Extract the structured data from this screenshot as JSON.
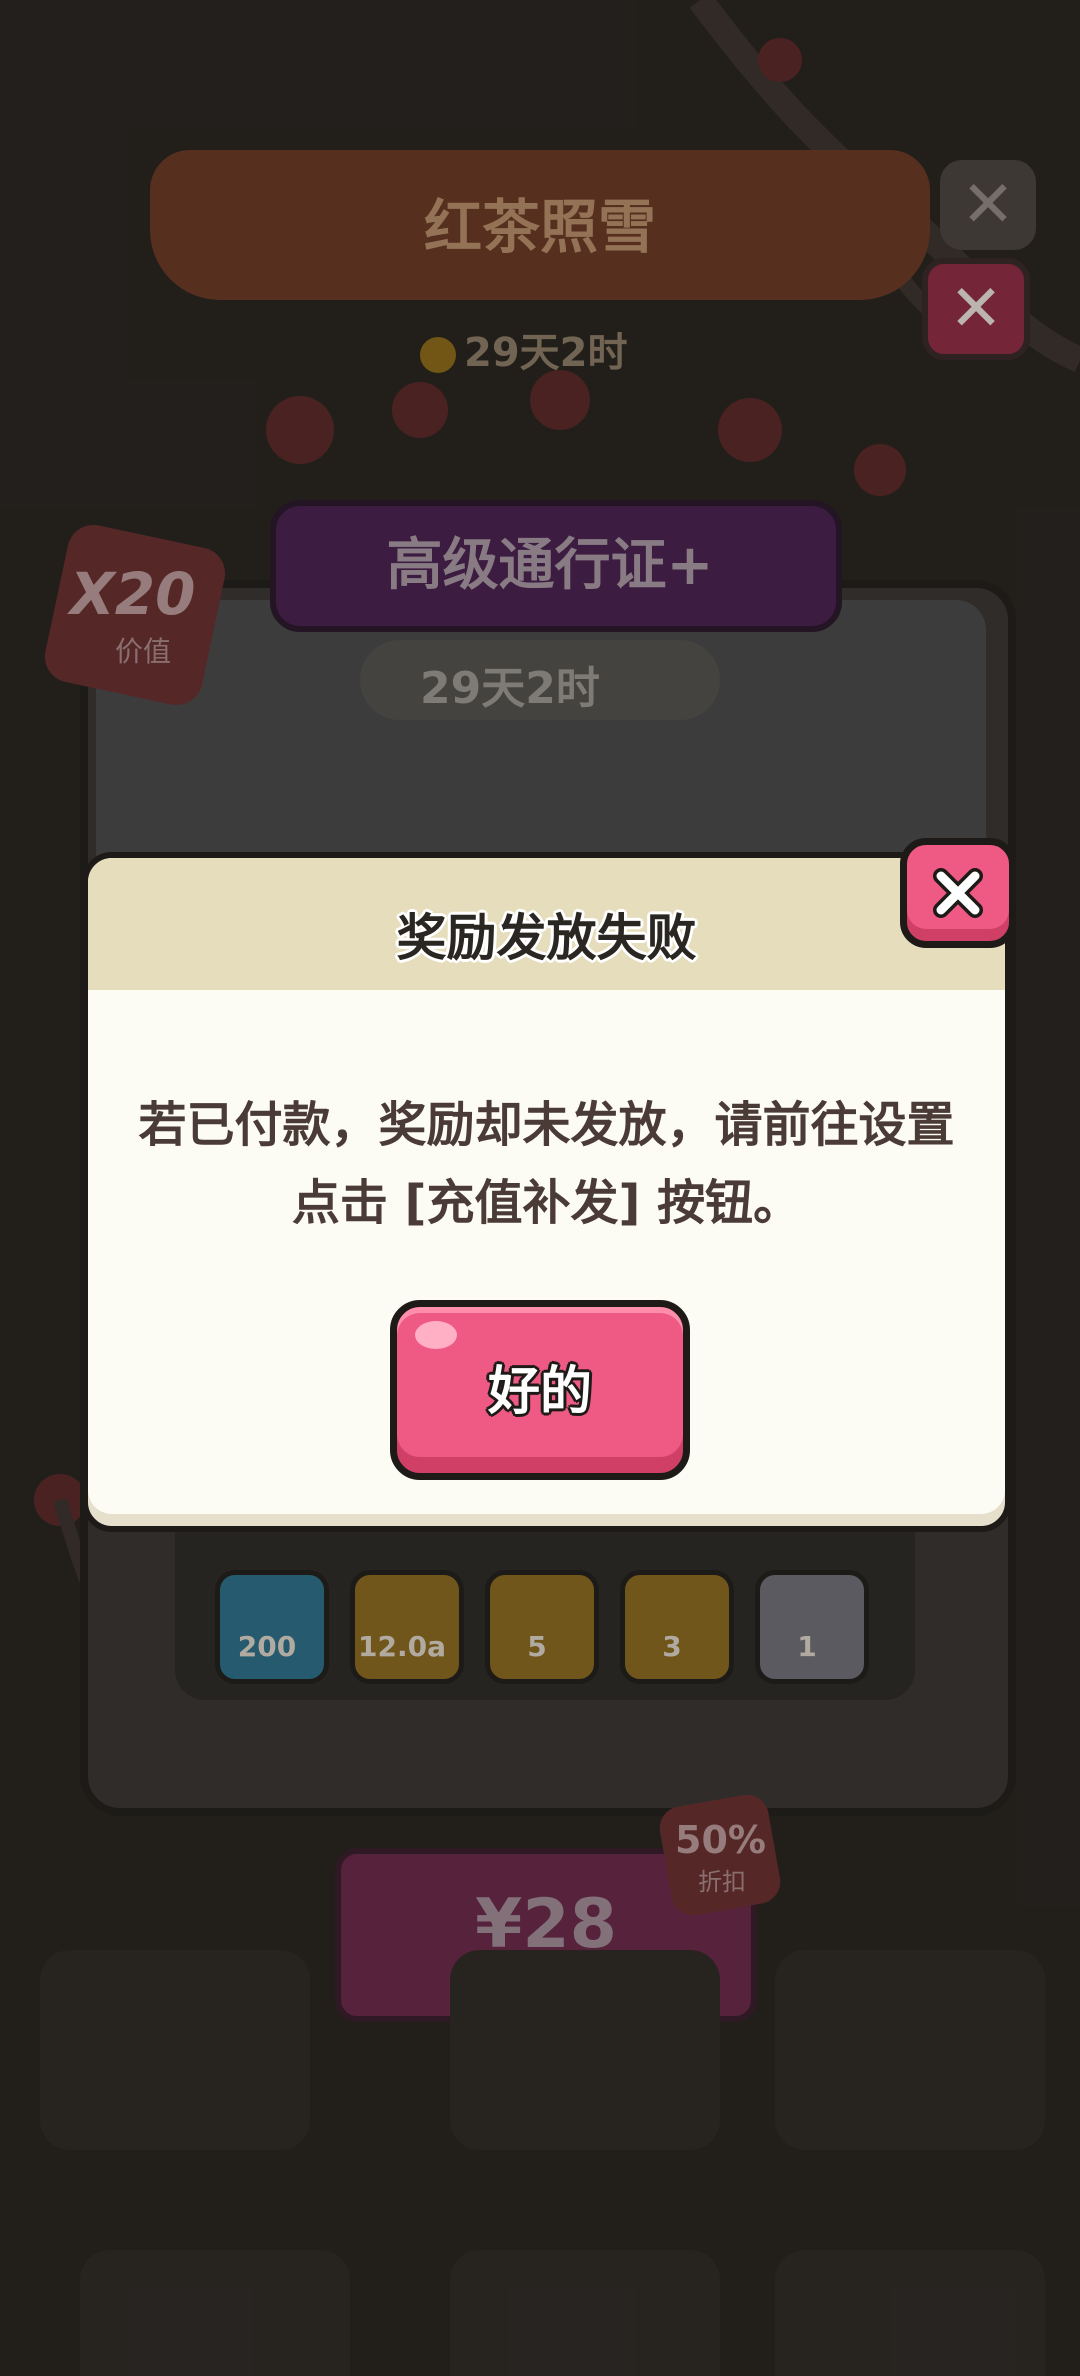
{
  "background": {
    "season_title": "红茶照雪",
    "season_timer": "29天2时",
    "pass_title": "高级通行证+",
    "pass_timer": "29天2时",
    "value_badge": {
      "multiplier": "X20",
      "label": "价值"
    },
    "items": [
      {
        "icon": "energy-icon",
        "qty": "200",
        "color": "#2f6f88"
      },
      {
        "icon": "cookie-icon",
        "qty": "12.0a",
        "color": "#8a6a22"
      },
      {
        "icon": "donut-icon",
        "qty": "5",
        "color": "#8a6a22"
      },
      {
        "icon": "card-pack-icon",
        "qty": "3",
        "color": "#8a6a22"
      },
      {
        "icon": "potion-icon",
        "qty": "1",
        "color": "#6e6e76"
      }
    ],
    "price": "¥28",
    "discount": {
      "percent": "50%",
      "label": "折扣"
    }
  },
  "dialog": {
    "title": "奖励发放失败",
    "message": "若已付款，奖励却未发放，请前往设置点击 [充值补发] 按钮。",
    "ok_label": "好的"
  },
  "colors": {
    "accent_pink": "#ef5a84",
    "dialog_bg": "#fdfcf4",
    "header_bg": "#e6ddbc"
  }
}
